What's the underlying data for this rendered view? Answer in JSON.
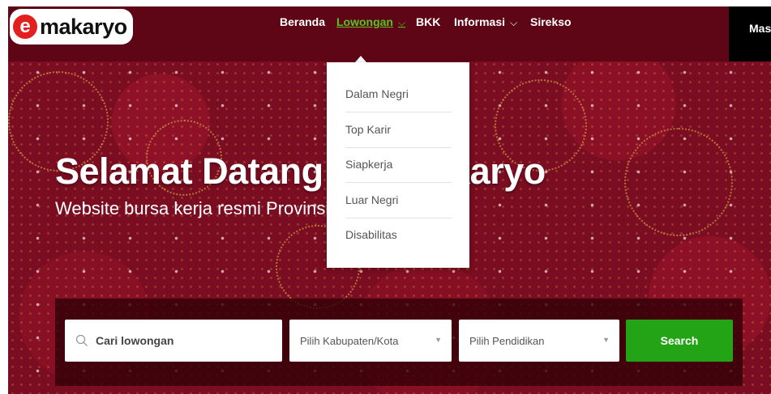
{
  "brand": {
    "logo_text": "makaryo",
    "logo_mark": "e"
  },
  "nav": {
    "items": [
      {
        "label": "Beranda"
      },
      {
        "label": "Lowongan"
      },
      {
        "label": "BKK"
      },
      {
        "label": "Informasi"
      },
      {
        "label": "Sirekso"
      }
    ],
    "chevron": "⌵",
    "login_label": "Masuk",
    "active_color": "#58c225"
  },
  "dropdown": {
    "items": [
      "Dalam Negri",
      "Top Karir",
      "Siapkerja",
      "Luar Negri",
      "Disabilitas"
    ]
  },
  "hero": {
    "title": "Selamat Datang di Emakaryo",
    "subtitle": "Website bursa kerja resmi Provinsi Jawa Tengah"
  },
  "search": {
    "placeholder": "Cari lowongan",
    "kabupaten_placeholder": "Pilih Kabupaten/Kota",
    "pendidikan_placeholder": "Pilih Pendidikan",
    "button_label": "Search",
    "button_color": "#23a417"
  },
  "colors": {
    "background": "#7a0d21",
    "navbar": "#5e0616"
  }
}
